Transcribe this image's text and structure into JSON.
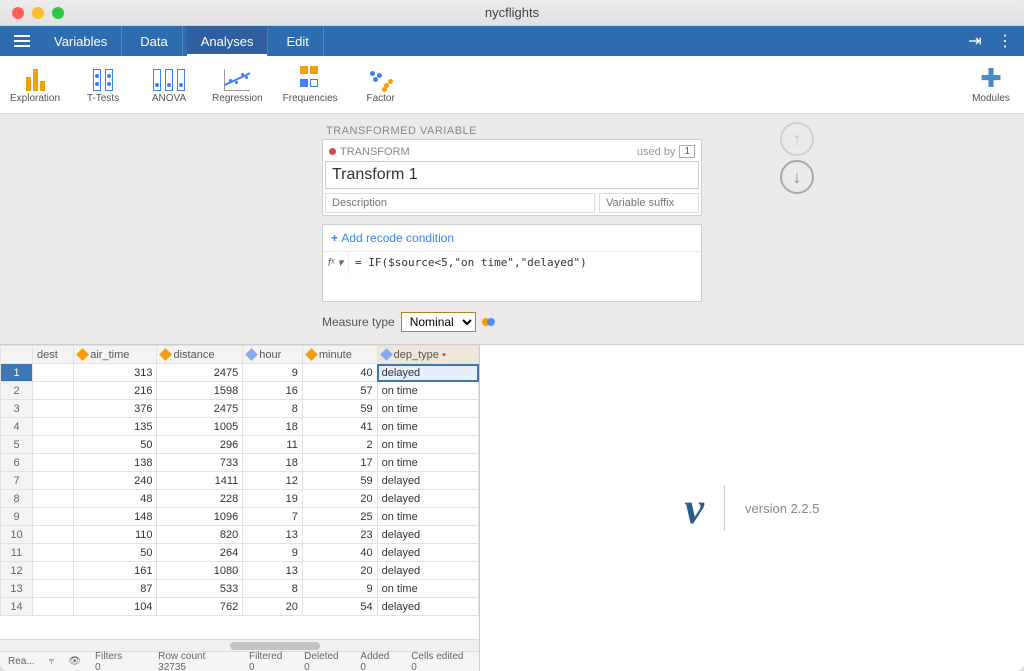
{
  "window": {
    "title": "nycflights"
  },
  "menubar": {
    "tabs": [
      {
        "label": "Variables"
      },
      {
        "label": "Data"
      },
      {
        "label": "Analyses"
      },
      {
        "label": "Edit"
      }
    ],
    "active_index": 2
  },
  "ribbon": {
    "items": [
      {
        "label": "Exploration"
      },
      {
        "label": "T-Tests"
      },
      {
        "label": "ANOVA"
      },
      {
        "label": "Regression"
      },
      {
        "label": "Frequencies"
      },
      {
        "label": "Factor"
      }
    ],
    "modules_label": "Modules"
  },
  "transform": {
    "section_title": "TRANSFORMED VARIABLE",
    "badge": "TRANSFORM",
    "usedby_label": "used by",
    "usedby_count": "1",
    "name_value": "Transform 1",
    "desc_placeholder": "Description",
    "suffix_placeholder": "Variable suffix",
    "add_recode_label": "Add recode condition",
    "fx_label": "fˣ ▾",
    "formula": "= IF($source<5,\"on time\",\"delayed\")",
    "measure_type_label": "Measure type",
    "measure_type_value": "Nominal"
  },
  "sheet": {
    "columns": [
      {
        "name": "dest",
        "type": "none"
      },
      {
        "name": "air_time",
        "type": "orange"
      },
      {
        "name": "distance",
        "type": "orange"
      },
      {
        "name": "hour",
        "type": "blue"
      },
      {
        "name": "minute",
        "type": "orange"
      },
      {
        "name": "dep_type",
        "type": "blue",
        "transformed": true
      }
    ],
    "rows": [
      {
        "n": 1,
        "air_time": 313,
        "distance": 2475,
        "hour": 9,
        "minute": 40,
        "dep_type": "delayed"
      },
      {
        "n": 2,
        "air_time": 216,
        "distance": 1598,
        "hour": 16,
        "minute": 57,
        "dep_type": "on time"
      },
      {
        "n": 3,
        "air_time": 376,
        "distance": 2475,
        "hour": 8,
        "minute": 59,
        "dep_type": "on time"
      },
      {
        "n": 4,
        "air_time": 135,
        "distance": 1005,
        "hour": 18,
        "minute": 41,
        "dep_type": "on time"
      },
      {
        "n": 5,
        "air_time": 50,
        "distance": 296,
        "hour": 11,
        "minute": 2,
        "dep_type": "on time"
      },
      {
        "n": 6,
        "air_time": 138,
        "distance": 733,
        "hour": 18,
        "minute": 17,
        "dep_type": "on time"
      },
      {
        "n": 7,
        "air_time": 240,
        "distance": 1411,
        "hour": 12,
        "minute": 59,
        "dep_type": "delayed"
      },
      {
        "n": 8,
        "air_time": 48,
        "distance": 228,
        "hour": 19,
        "minute": 20,
        "dep_type": "delayed"
      },
      {
        "n": 9,
        "air_time": 148,
        "distance": 1096,
        "hour": 7,
        "minute": 25,
        "dep_type": "on time"
      },
      {
        "n": 10,
        "air_time": 110,
        "distance": 820,
        "hour": 13,
        "minute": 23,
        "dep_type": "delayed"
      },
      {
        "n": 11,
        "air_time": 50,
        "distance": 264,
        "hour": 9,
        "minute": 40,
        "dep_type": "delayed"
      },
      {
        "n": 12,
        "air_time": 161,
        "distance": 1080,
        "hour": 13,
        "minute": 20,
        "dep_type": "delayed"
      },
      {
        "n": 13,
        "air_time": 87,
        "distance": 533,
        "hour": 8,
        "minute": 9,
        "dep_type": "on time"
      },
      {
        "n": 14,
        "air_time": 104,
        "distance": 762,
        "hour": 20,
        "minute": 54,
        "dep_type": "delayed"
      }
    ],
    "selected_row": 1,
    "selected_col": "dep_type"
  },
  "statusbar": {
    "ready": "Rea...",
    "filters": "Filters 0",
    "rowcount": "Row count 32735",
    "filtered": "Filtered 0",
    "deleted": "Deleted 0",
    "added": "Added 0",
    "edited": "Cells edited 0"
  },
  "results": {
    "logo": "ν",
    "version_text": "version 2.2.5"
  }
}
